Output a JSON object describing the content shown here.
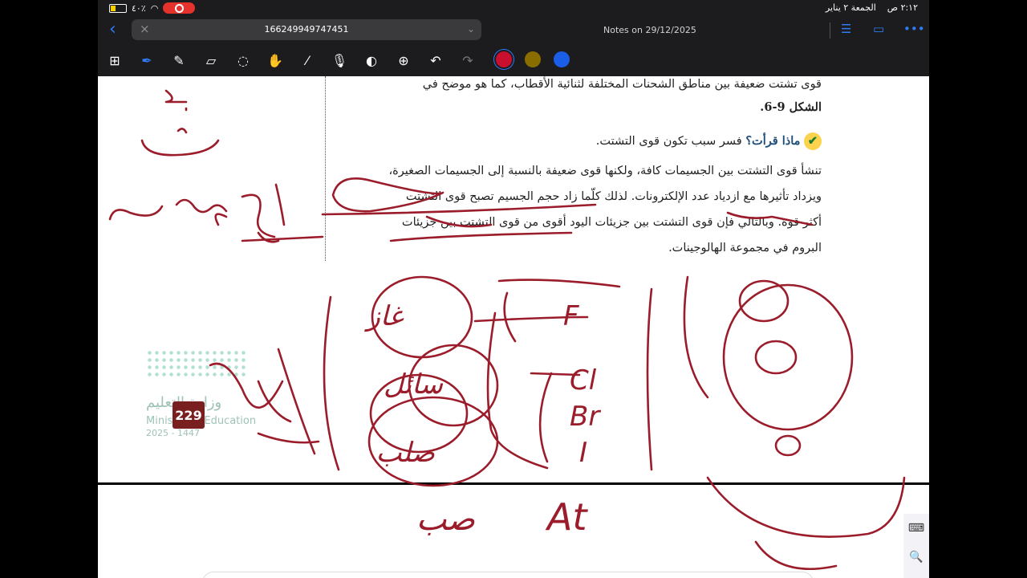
{
  "status": {
    "time": "٢:١٢ ص",
    "date": "الجمعة ٢ يناير",
    "battery": "٤٠٪"
  },
  "toolbar": {
    "address": "166249949747451",
    "doc_title": "Notes on 29/12/2025"
  },
  "tools": [
    "grid-icon",
    "pen-icon",
    "highlighter-icon",
    "eraser-icon",
    "lasso-icon",
    "hand-icon",
    "pipette-icon",
    "microphone-icon",
    "shape-icon",
    "add-icon",
    "undo-icon",
    "redo-icon"
  ],
  "colors": {
    "red": "#c8102e",
    "olive": "#8a6d00",
    "blue": "#1a5ee8",
    "ink": "#9b1c2a"
  },
  "doc": {
    "line1": "قوى تشتت ضعيفة بين مناطق الشحنات المختلفة لثنائية الأقطاب، كما هو موضح في",
    "line2": "الشكل 9-6.",
    "q_label": "ماذا قرأت؟",
    "q_text": "فسر سبب تكون قوى التشتت.",
    "p1": "تنشأ قوى التشتت بين الجسيمات كافة، ولكنها قوى ضعيفة بالنسبة إلى الجسيمات الصغيرة،",
    "p2": "ويزداد تأثيرها مع ازدياد عدد الإلكترونات. لذلك كلّما زاد حجم الجسيم تصبح قوى التشتت",
    "p3": "أكثر قوة. وبالتالي فإن قوى التشتت بين جزيئات اليود أقوى من قوى التشتت بين جزيئات",
    "p4": "البروم في مجموعة الهالوجينات."
  },
  "page_number": "229",
  "ministry": {
    "ar": "وزارة التعليم",
    "en": "Ministry of Education",
    "year": "2025 - 1447"
  },
  "ink_text": {
    "F": "F",
    "Cl": "Cl",
    "Br": "Br",
    "I": "I",
    "At": "At",
    "ghaz": "غاز",
    "saael": "سائل",
    "salb": "صلب",
    "sub": "صب"
  }
}
